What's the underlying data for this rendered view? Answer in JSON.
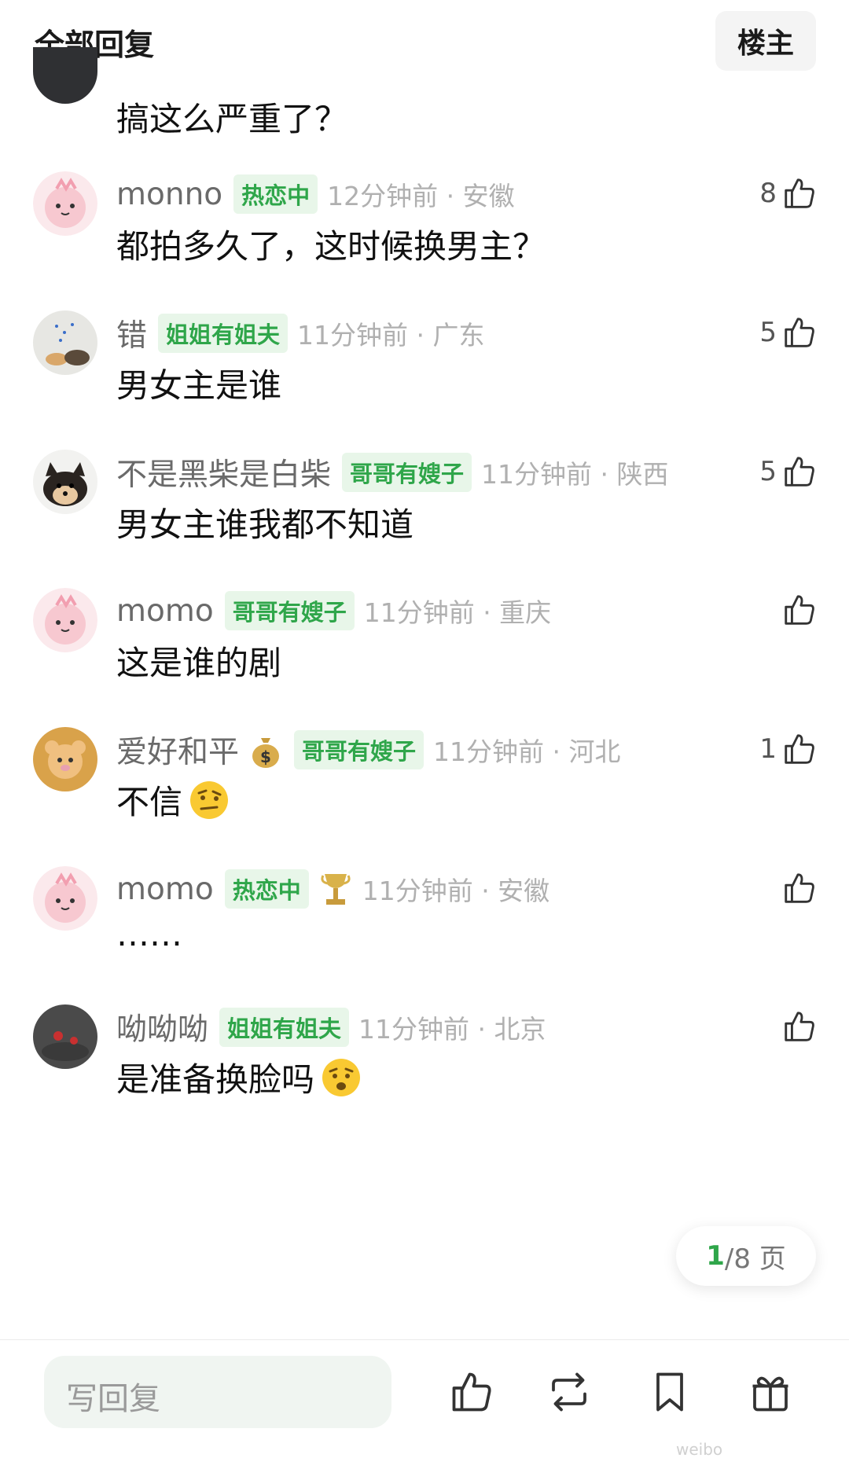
{
  "header": {
    "title": "全部回复",
    "op_button": "楼主"
  },
  "partial_comment": {
    "text": "搞这么严重了？"
  },
  "comments": [
    {
      "username": "monno",
      "flair": "热恋中",
      "time": "12分钟前 · 安徽",
      "text": "都拍多久了，这时候换男主？",
      "likes": "8",
      "avatar": "pink-cartoon-avatar"
    },
    {
      "username": "错",
      "flair": "姐姐有姐夫",
      "time": "11分钟前 · 广东",
      "text": "男女主是谁",
      "likes": "5",
      "avatar": "photo-avatar"
    },
    {
      "username": "不是黑柴是白柴",
      "flair": "哥哥有嫂子",
      "time": "11分钟前 · 陕西",
      "text": "男女主谁我都不知道",
      "likes": "5",
      "avatar": "shiba-dog-avatar"
    },
    {
      "username": "momo",
      "flair": "哥哥有嫂子",
      "time": "11分钟前 · 重庆",
      "text": "这是谁的剧",
      "likes": "",
      "avatar": "pink-cartoon-avatar"
    },
    {
      "username": "爱好和平",
      "flair": "哥哥有嫂子",
      "time": "11分钟前 · 河北",
      "text": "不信",
      "likes": "1",
      "avatar": "bear-avatar",
      "name_badge": "money-bag-icon",
      "emoji": "raised-eyebrow-emoji"
    },
    {
      "username": "momo",
      "flair": "热恋中",
      "time": "11分钟前 · 安徽",
      "text": "……",
      "likes": "",
      "avatar": "pink-cartoon-avatar",
      "extra_badge": "trophy-icon"
    },
    {
      "username": "呦呦呦",
      "flair": "姐姐有姐夫",
      "time": "11分钟前 · 北京",
      "text": "是准备换脸吗",
      "likes": "",
      "avatar": "dark-photo-avatar",
      "emoji": "surprised-face-emoji"
    }
  ],
  "pager": {
    "current": "1",
    "rest": "/8 页"
  },
  "bottom_bar": {
    "reply_placeholder": "写回复"
  },
  "watermark": "weibo",
  "colors": {
    "flair_bg": "#e8f6e9",
    "flair_text": "#2fa64a",
    "accent": "#2fa64a"
  }
}
